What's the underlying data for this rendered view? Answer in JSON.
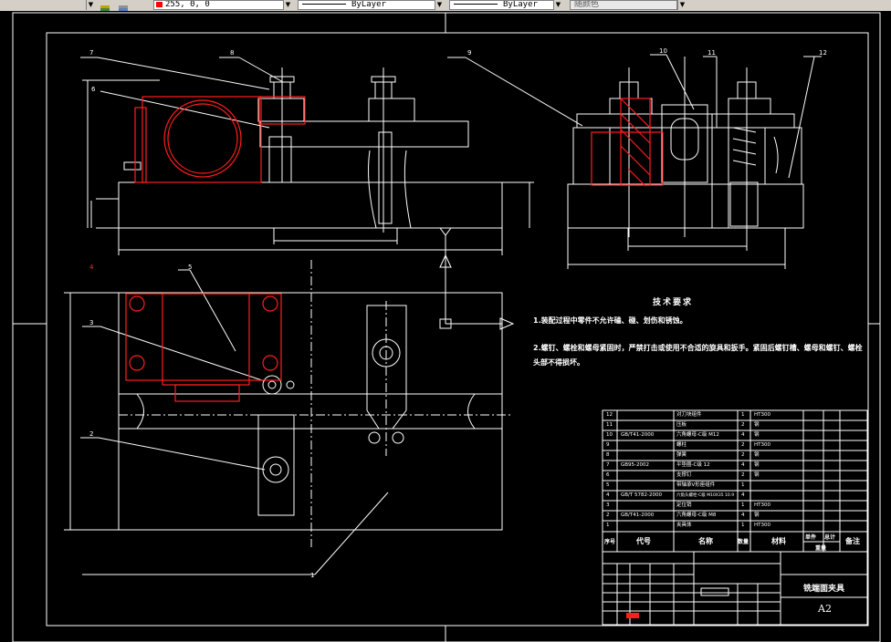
{
  "toolbar": {
    "color_value": "255, 0, 0",
    "linetype_value": "ByLayer",
    "lineweight_value": "ByLayer",
    "plotstyle_value": "随颜色"
  },
  "colors": {
    "background": "#000000",
    "lines": "#ffffff",
    "highlight": "#ff0000",
    "toolbar_bg": "#d4d0c8"
  },
  "drawing": {
    "part_labels": {
      "p1": "1",
      "p2": "2",
      "p3": "3",
      "p4": "4",
      "p5": "5",
      "p6": "6",
      "p7": "7",
      "p8": "8",
      "p9": "9",
      "p10": "10",
      "p11": "11",
      "p12": "12"
    },
    "technical_requirements": {
      "title": "技术要求",
      "item1": "1.装配过程中零件不允许磕、碰、划伤和锈蚀。",
      "item2a": "2.螺钉、螺栓和螺母紧固时，严禁打击或使用不合适的旋具和扳手。紧固后螺钉槽、螺母和螺钉、螺栓",
      "item2b": "头部不得损坏。"
    },
    "bom_rows": [
      {
        "no": "12",
        "code": "",
        "name": "对刀块组件",
        "qty": "1",
        "mat": "HT300"
      },
      {
        "no": "11",
        "code": "",
        "name": "压板",
        "qty": "2",
        "mat": "钢"
      },
      {
        "no": "10",
        "code": "GB/T41-2000",
        "name": "六角螺母-C级 M12",
        "qty": "4",
        "mat": "钢"
      },
      {
        "no": "9",
        "code": "",
        "name": "螺柱",
        "qty": "2",
        "mat": "HT300"
      },
      {
        "no": "8",
        "code": "",
        "name": "弹簧",
        "qty": "2",
        "mat": "钢"
      },
      {
        "no": "7",
        "code": "GB95-2002",
        "name": "平垫圈-C级 12",
        "qty": "4",
        "mat": "钢"
      },
      {
        "no": "6",
        "code": "",
        "name": "支撑钉",
        "qty": "2",
        "mat": "钢"
      },
      {
        "no": "5",
        "code": "",
        "name": "带轴承V形座组件",
        "qty": "1",
        "mat": ""
      },
      {
        "no": "4",
        "code": "GB/T 5782-2000",
        "name": "六角头螺栓-C级 M10X35 10.9",
        "qty": "4",
        "mat": ""
      },
      {
        "no": "3",
        "code": "",
        "name": "定位销",
        "qty": "1",
        "mat": "HT300"
      },
      {
        "no": "2",
        "code": "GB/T41-2000",
        "name": "六角螺母-C级 M8",
        "qty": "4",
        "mat": "钢"
      },
      {
        "no": "1",
        "code": "",
        "name": "夹具体",
        "qty": "1",
        "mat": "HT300"
      }
    ],
    "bom_header": {
      "seq": "序号",
      "code": "代号",
      "name": "名称",
      "qty": "数量",
      "mat": "材料",
      "unit_weight": "单件",
      "total_weight": "总计",
      "weight": "重量",
      "remark": "备注"
    },
    "title_block": {
      "drawing_name": "铣端面夹具",
      "sheet_size": "A2"
    }
  }
}
